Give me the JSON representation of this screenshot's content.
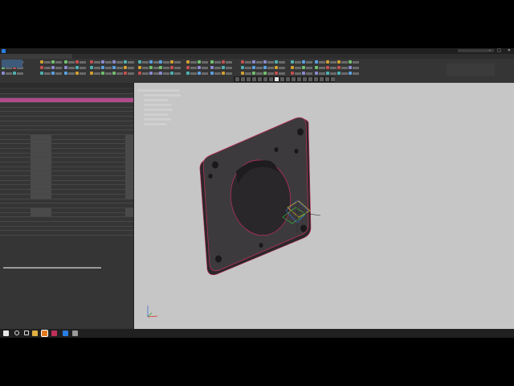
{
  "colors": {
    "accent": "#2a7de1",
    "selection": "#b04a8a",
    "viewport_bg": "#c6c6c6",
    "part_fill": "#3d3a3d",
    "edge": "#c0305a"
  },
  "menu": {
    "items": []
  },
  "window": {
    "controls": [
      "–",
      "□",
      "✕"
    ]
  },
  "tree": {
    "rows": [
      {
        "type": "header"
      },
      {
        "type": "group"
      },
      {
        "type": "selected"
      },
      {
        "type": "group"
      },
      {
        "type": "group"
      },
      {
        "type": "group"
      },
      {
        "type": "group"
      },
      {
        "type": "group"
      },
      {
        "type": "group"
      },
      {
        "type": "group"
      },
      {
        "type": "data"
      },
      {
        "type": "data"
      },
      {
        "type": "data"
      },
      {
        "type": "data"
      },
      {
        "type": "data"
      },
      {
        "type": "data"
      },
      {
        "type": "data"
      },
      {
        "type": "data"
      },
      {
        "type": "data"
      },
      {
        "type": "data"
      },
      {
        "type": "data"
      },
      {
        "type": "data"
      },
      {
        "type": "data"
      },
      {
        "type": "data"
      },
      {
        "type": "group"
      },
      {
        "type": "group"
      },
      {
        "type": "data"
      },
      {
        "type": "data"
      },
      {
        "type": "group"
      },
      {
        "type": "group"
      },
      {
        "type": "group"
      },
      {
        "type": "group"
      }
    ]
  },
  "taskbar": {
    "icons": [
      "windows-start-icon",
      "search-icon",
      "task-view-icon",
      "file-explorer-icon",
      "app-icon-orange",
      "app-icon-kompas",
      "app-icon-blue",
      "app-icon-gray"
    ],
    "tray_text": "",
    "clock_time": "",
    "clock_date": ""
  }
}
